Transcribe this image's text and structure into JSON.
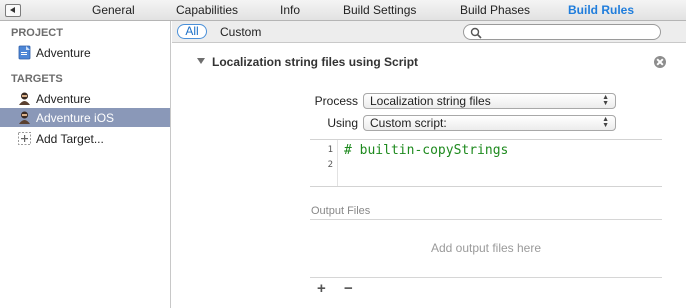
{
  "tabs": [
    {
      "label": "General"
    },
    {
      "label": "Capabilities"
    },
    {
      "label": "Info"
    },
    {
      "label": "Build Settings"
    },
    {
      "label": "Build Phases"
    },
    {
      "label": "Build Rules",
      "active": true
    }
  ],
  "sidebar": {
    "project_header": "PROJECT",
    "project_item": {
      "label": "Adventure",
      "icon": "project-file-icon"
    },
    "targets_header": "TARGETS",
    "targets": [
      {
        "label": "Adventure",
        "icon": "app-target-icon"
      },
      {
        "label": "Adventure iOS",
        "icon": "app-target-icon",
        "selected": true
      }
    ],
    "add_target": {
      "label": "Add Target...",
      "icon": "add-target-icon"
    }
  },
  "filter": {
    "all_label": "All",
    "custom_label": "Custom",
    "search_placeholder": ""
  },
  "rule": {
    "title": "Localization string files using Script",
    "process_label": "Process",
    "process_value": "Localization string files",
    "using_label": "Using",
    "using_value": "Custom script:",
    "script_lines": [
      {
        "num": "1",
        "text": "# builtin-copyStrings"
      },
      {
        "num": "2",
        "text": ""
      }
    ],
    "output_files_label": "Output Files",
    "output_placeholder": "Add output files here",
    "add_symbol": "+",
    "remove_symbol": "−"
  },
  "colors": {
    "accent": "#1f7ddc",
    "selection": "#8a98b8",
    "script_text": "#1e8a1e"
  }
}
